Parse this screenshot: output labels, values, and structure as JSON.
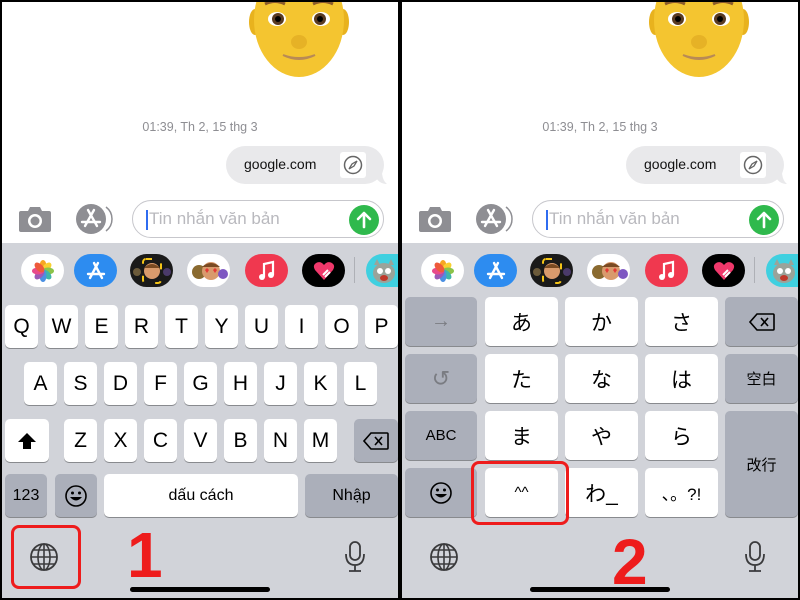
{
  "panels": [
    {
      "step": "1",
      "timestamp": "01:39, Th 2, 15 thg 3",
      "bubble": {
        "text": "google.com",
        "icon": "compass-icon"
      },
      "input": {
        "placeholder": "Tin nhắn văn bản"
      },
      "app_strip": [
        "photos",
        "app-store",
        "memoji-camera",
        "memoji-stickers",
        "music",
        "digital-touch",
        "talking-tom"
      ],
      "keyboard": {
        "type": "qwerty",
        "row1": [
          "Q",
          "W",
          "E",
          "R",
          "T",
          "Y",
          "U",
          "I",
          "O",
          "P"
        ],
        "row2": [
          "A",
          "S",
          "D",
          "F",
          "G",
          "H",
          "J",
          "K",
          "L"
        ],
        "row3": [
          "Z",
          "X",
          "C",
          "V",
          "B",
          "N",
          "M"
        ],
        "numbers_label": "123",
        "space_label": "dấu cách",
        "return_label": "Nhập"
      },
      "highlight": "globe-key"
    },
    {
      "step": "2",
      "timestamp": "01:39, Th 2, 15 thg 3",
      "bubble": {
        "text": "google.com",
        "icon": "compass-icon"
      },
      "input": {
        "placeholder": "Tin nhắn văn bản"
      },
      "app_strip": [
        "photos",
        "app-store",
        "memoji-camera",
        "memoji-stickers",
        "music",
        "digital-touch",
        "talking-tom"
      ],
      "keyboard": {
        "type": "kana",
        "left": [
          "→",
          "↺",
          "ABC"
        ],
        "grid": [
          [
            "あ",
            "か",
            "さ"
          ],
          [
            "た",
            "な",
            "は"
          ],
          [
            "ま",
            "や",
            "ら"
          ],
          [
            "^^",
            "わ_",
            "、。?!"
          ]
        ],
        "space_label": "空白",
        "return_label": "改行"
      },
      "highlight": "kaomoji-key"
    }
  ],
  "colors": {
    "annotation_red": "#ee1c1c",
    "send_green": "#2fb94d",
    "keyboard_bg": "#d1d3d9",
    "dark_key": "#abafba"
  }
}
